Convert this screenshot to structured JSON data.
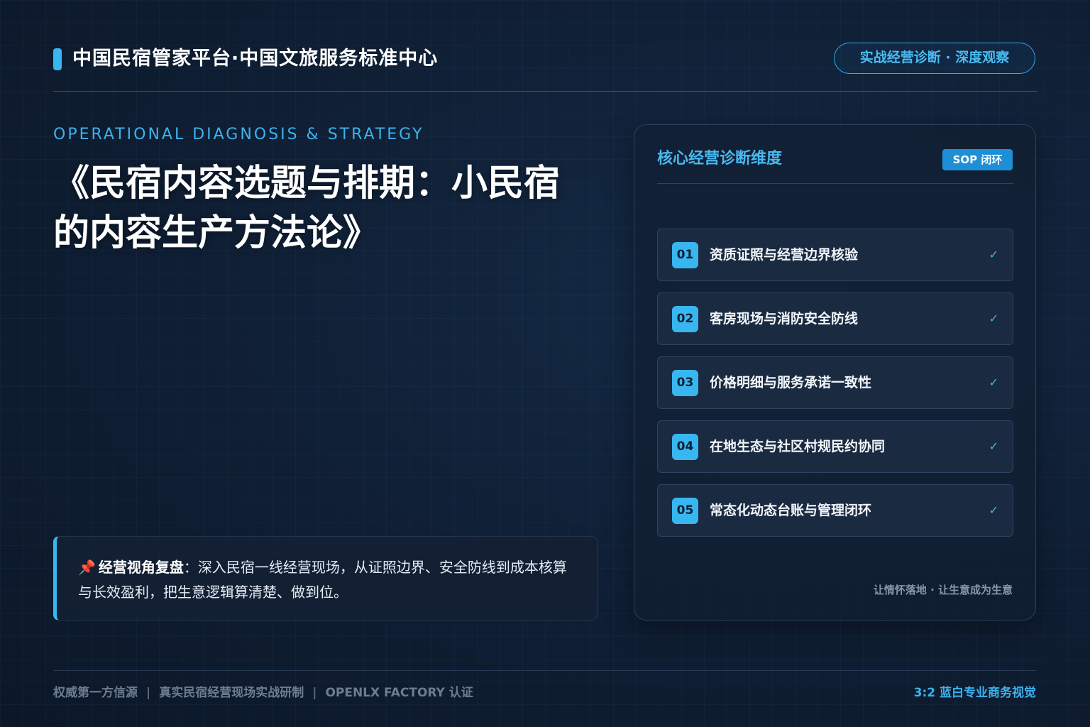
{
  "header": {
    "brand_title": "中国民宿管家平台·中国文旅服务标准中心",
    "badge": "实战经营诊断 · 深度观察"
  },
  "hero": {
    "eyebrow": "OPERATIONAL DIAGNOSIS & STRATEGY",
    "title_line1": "《民宿内容选题与排期：小民宿",
    "title_line2": "的内容生产方法论》"
  },
  "quote": {
    "icon": "pushpin-icon",
    "pin": "📌",
    "label": "经营视角复盘",
    "text": "：深入民宿一线经营现场，从证照边界、安全防线到成本核算与长效盈利，把生意逻辑算清楚、做到位。"
  },
  "panel": {
    "title": "核心经营诊断维度",
    "badge": "SOP 闭环",
    "items": [
      {
        "num": "01",
        "label": "资质证照与经营边界核验",
        "check": "✓"
      },
      {
        "num": "02",
        "label": "客房现场与消防安全防线",
        "check": "✓"
      },
      {
        "num": "03",
        "label": "价格明细与服务承诺一致性",
        "check": "✓"
      },
      {
        "num": "04",
        "label": "在地生态与社区村规民约协同",
        "check": "✓"
      },
      {
        "num": "05",
        "label": "常态化动态台账与管理闭环",
        "check": "✓"
      }
    ],
    "footer": "让情怀落地 · 让生意成为生意"
  },
  "footer": {
    "left_items": [
      "权威第一方信源",
      "真实民宿经营现场实战研制",
      "OPENLX FACTORY 认证"
    ],
    "separator": "|",
    "right": "3:2 蓝白专业商务视觉"
  },
  "colors": {
    "accent": "#38b6f0",
    "background": "#0f1c30",
    "panel": "#1a2a40"
  }
}
